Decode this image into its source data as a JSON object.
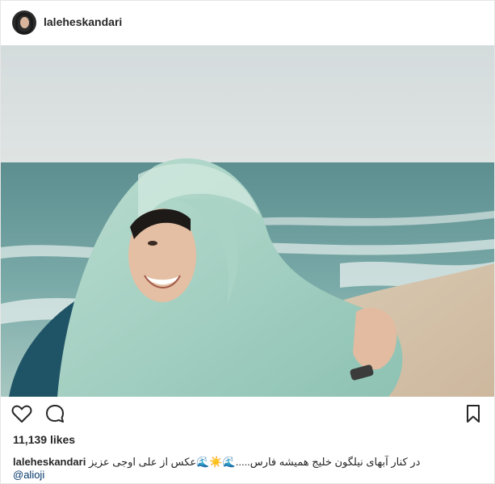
{
  "header": {
    "username": "laleheskandari",
    "avatar_icon": "profile-avatar"
  },
  "photo": {
    "subject": "beach-portrait-photo"
  },
  "actions": {
    "like_icon": "heart-outline-icon",
    "comment_icon": "speech-bubble-icon",
    "save_icon": "bookmark-icon"
  },
  "likes": {
    "text": "11,139 likes"
  },
  "caption": {
    "username": "laleheskandari",
    "text": "در کنار آبهای نیلگون خلیج همیشه فارس.....🌊☀️🌊عکس از علی اوجی عزیز"
  },
  "mention": {
    "text": "@alioji"
  },
  "colors": {
    "text": "#262626",
    "link": "#003569",
    "border": "#e6e6e6"
  }
}
